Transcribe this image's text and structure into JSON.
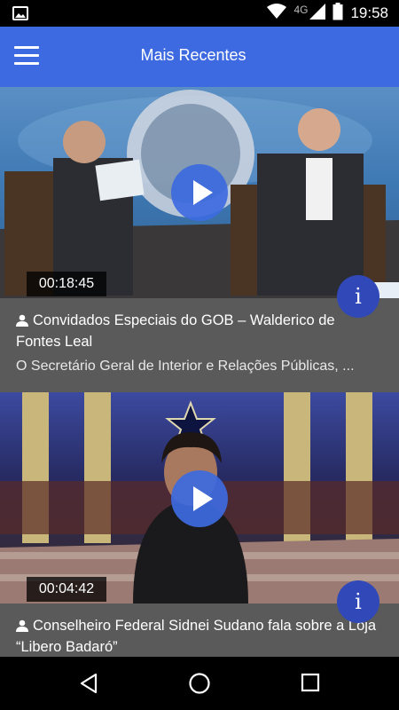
{
  "status_bar": {
    "time": "19:58",
    "network": "4G",
    "icons": [
      "image-notification-icon",
      "wifi-icon",
      "cell-signal-icon",
      "battery-icon"
    ]
  },
  "app_bar": {
    "title": "Mais Recentes",
    "menu_icon": "hamburger-menu-icon",
    "color": "#3d6ae0"
  },
  "videos": [
    {
      "duration": "00:18:45",
      "title": "Convidados Especiais do GOB – Walderico de Fontes Leal",
      "description": "O Secretário Geral de Interior e Relações Públicas, ...",
      "play_icon": "play-icon",
      "info_icon": "info-icon"
    },
    {
      "duration": "00:04:42",
      "title": "Conselheiro Federal Sidnei Sudano fala sobre a Loja “Libero Badaró”",
      "play_icon": "play-icon",
      "info_icon": "info-icon"
    }
  ],
  "nav_bar": {
    "buttons": [
      "back-icon",
      "home-icon",
      "recents-icon"
    ]
  },
  "colors": {
    "accent": "#3d6ae0",
    "info_button": "#3048b8",
    "caption_bg": "#5a5a5a"
  }
}
